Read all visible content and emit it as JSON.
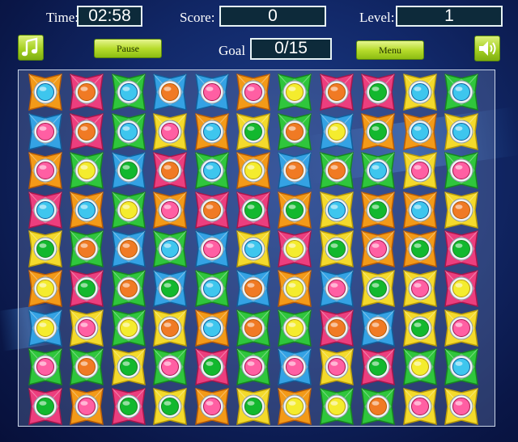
{
  "hud": {
    "time_label": "Time:",
    "time_value": "02:58",
    "score_label": "Score:",
    "score_value": "0",
    "level_label": "Level:",
    "level_value": "1",
    "goal_label": "Goal",
    "goal_value": "0/15",
    "pause_label": "Pause",
    "menu_label": "Menu",
    "music_icon": "music-note-icon",
    "sound_icon": "speaker-icon"
  },
  "palette": {
    "o": {
      "tile": "#f39a18",
      "dark": "#b85c06",
      "gem": "#f07a24"
    },
    "r": {
      "tile": "#ec3e7e",
      "dark": "#a8164c",
      "gem": "#ff5fa3"
    },
    "g": {
      "tile": "#2fc63c",
      "dark": "#17851f",
      "gem": "#12b82e"
    },
    "b": {
      "tile": "#34a2e4",
      "dark": "#11609c",
      "gem": "#3ec6ee"
    },
    "y": {
      "tile": "#f4da2c",
      "dark": "#b89a08",
      "gem": "#f4ec2e"
    }
  },
  "board": [
    [
      [
        "o",
        "b"
      ],
      [
        "r",
        "o"
      ],
      [
        "g",
        "b"
      ],
      [
        "b",
        "o"
      ],
      [
        "b",
        "r"
      ],
      [
        "o",
        "r"
      ],
      [
        "g",
        "y"
      ],
      [
        "r",
        "o"
      ],
      [
        "r",
        "g"
      ],
      [
        "y",
        "b"
      ],
      [
        "g",
        "b"
      ]
    ],
    [
      [
        "b",
        "r"
      ],
      [
        "r",
        "o"
      ],
      [
        "g",
        "b"
      ],
      [
        "y",
        "r"
      ],
      [
        "o",
        "b"
      ],
      [
        "y",
        "g"
      ],
      [
        "g",
        "o"
      ],
      [
        "b",
        "y"
      ],
      [
        "o",
        "g"
      ],
      [
        "o",
        "b"
      ],
      [
        "y",
        "b"
      ]
    ],
    [
      [
        "o",
        "r"
      ],
      [
        "g",
        "y"
      ],
      [
        "b",
        "g"
      ],
      [
        "r",
        "o"
      ],
      [
        "g",
        "b"
      ],
      [
        "o",
        "y"
      ],
      [
        "b",
        "o"
      ],
      [
        "g",
        "o"
      ],
      [
        "g",
        "b"
      ],
      [
        "y",
        "r"
      ],
      [
        "g",
        "r"
      ]
    ],
    [
      [
        "r",
        "b"
      ],
      [
        "o",
        "b"
      ],
      [
        "g",
        "y"
      ],
      [
        "o",
        "r"
      ],
      [
        "r",
        "o"
      ],
      [
        "r",
        "g"
      ],
      [
        "o",
        "g"
      ],
      [
        "y",
        "b"
      ],
      [
        "o",
        "g"
      ],
      [
        "o",
        "b"
      ],
      [
        "y",
        "o"
      ]
    ],
    [
      [
        "y",
        "g"
      ],
      [
        "g",
        "o"
      ],
      [
        "b",
        "o"
      ],
      [
        "g",
        "b"
      ],
      [
        "b",
        "r"
      ],
      [
        "y",
        "b"
      ],
      [
        "r",
        "y"
      ],
      [
        "y",
        "g"
      ],
      [
        "o",
        "r"
      ],
      [
        "o",
        "g"
      ],
      [
        "r",
        "g"
      ]
    ],
    [
      [
        "o",
        "y"
      ],
      [
        "r",
        "g"
      ],
      [
        "g",
        "o"
      ],
      [
        "b",
        "g"
      ],
      [
        "g",
        "b"
      ],
      [
        "b",
        "o"
      ],
      [
        "o",
        "y"
      ],
      [
        "b",
        "r"
      ],
      [
        "y",
        "g"
      ],
      [
        "y",
        "r"
      ],
      [
        "r",
        "y"
      ]
    ],
    [
      [
        "b",
        "y"
      ],
      [
        "y",
        "r"
      ],
      [
        "g",
        "y"
      ],
      [
        "y",
        "o"
      ],
      [
        "o",
        "b"
      ],
      [
        "g",
        "o"
      ],
      [
        "g",
        "y"
      ],
      [
        "r",
        "o"
      ],
      [
        "b",
        "o"
      ],
      [
        "y",
        "g"
      ],
      [
        "y",
        "r"
      ]
    ],
    [
      [
        "g",
        "r"
      ],
      [
        "g",
        "o"
      ],
      [
        "y",
        "g"
      ],
      [
        "g",
        "r"
      ],
      [
        "r",
        "g"
      ],
      [
        "g",
        "r"
      ],
      [
        "b",
        "r"
      ],
      [
        "y",
        "r"
      ],
      [
        "r",
        "g"
      ],
      [
        "g",
        "y"
      ],
      [
        "g",
        "b"
      ]
    ],
    [
      [
        "r",
        "g"
      ],
      [
        "o",
        "r"
      ],
      [
        "r",
        "g"
      ],
      [
        "y",
        "g"
      ],
      [
        "o",
        "r"
      ],
      [
        "y",
        "g"
      ],
      [
        "o",
        "y"
      ],
      [
        "g",
        "y"
      ],
      [
        "g",
        "o"
      ],
      [
        "y",
        "r"
      ],
      [
        "y",
        "r"
      ]
    ]
  ]
}
